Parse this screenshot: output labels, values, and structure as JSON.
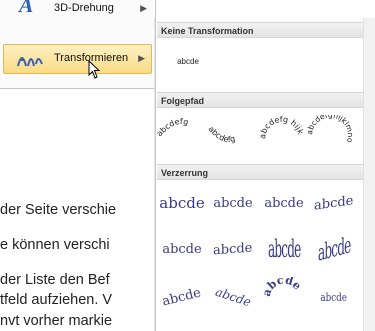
{
  "menu": {
    "item_3d": {
      "label": "3D-Drehung",
      "icon": "3d-rotation-icon"
    },
    "item_transform": {
      "label": "Transformieren",
      "icon": "transform-abc-icon"
    }
  },
  "document_lines": [
    "der Seite verschie",
    "e können verschi",
    "der Liste den Bef",
    "tfeld aufziehen. V",
    "nvt vorher markie"
  ],
  "gallery": {
    "sections": [
      {
        "title": "Keine Transformation"
      },
      {
        "title": "Folgepfad"
      },
      {
        "title": "Verzerrung"
      }
    ],
    "none_sample": "abcde",
    "path_samples": [
      "abcdefg",
      "abcdefg",
      "abcdefg hijk",
      "abcdefghijklmno"
    ],
    "warp_samples": [
      "abcde",
      "abcde",
      "abcde",
      "abcde",
      "abcde",
      "abcde",
      "abcde",
      "abcde",
      "abcde",
      "abcde",
      "abcde",
      "abcde"
    ]
  }
}
